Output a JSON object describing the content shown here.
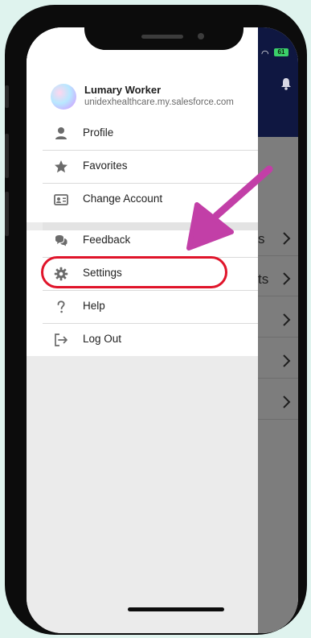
{
  "status_bar": {
    "battery": "61"
  },
  "user": {
    "name": "Lumary Worker",
    "domain": "unidexhealthcare.my.salesforce.com"
  },
  "menu": {
    "items": [
      {
        "label": "Profile",
        "icon": "person-icon"
      },
      {
        "label": "Favorites",
        "icon": "star-icon"
      },
      {
        "label": "Change Account",
        "icon": "id-card-icon"
      },
      {
        "label": "Feedback",
        "icon": "chat-bubbles-icon"
      },
      {
        "label": "Settings",
        "icon": "gear-icon"
      },
      {
        "label": "Help",
        "icon": "question-icon"
      },
      {
        "label": "Log Out",
        "icon": "logout-icon"
      }
    ]
  },
  "behind_app": {
    "rows": [
      {
        "text": "s"
      },
      {
        "text": "ts"
      },
      {
        "text": ""
      },
      {
        "text": ""
      },
      {
        "text": ""
      }
    ]
  },
  "colors": {
    "background": "#dff3ee",
    "app_header": "#0f1741",
    "highlight": "#e0142a",
    "arrow": "#c23fa7"
  }
}
